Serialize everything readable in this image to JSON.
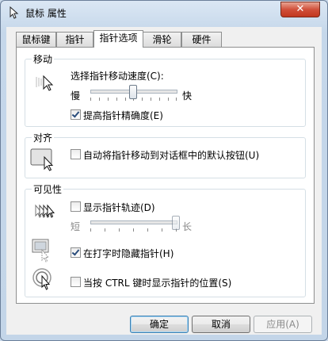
{
  "window": {
    "title": "鼠标 属性",
    "close_label": "✕"
  },
  "tabs": [
    {
      "label": "鼠标键"
    },
    {
      "label": "指针"
    },
    {
      "label": "指针选项",
      "active": true
    },
    {
      "label": "滑轮"
    },
    {
      "label": "硬件"
    }
  ],
  "motion": {
    "title": "移动",
    "speed_label": "选择指针移动速度(C):",
    "slow_label": "慢",
    "fast_label": "快",
    "speed_level_fraction": 0.5,
    "precision_label": "提高指针精确度(E)",
    "precision_checked": true
  },
  "snap": {
    "title": "对齐",
    "snap_label": "自动将指针移动到对话框中的默认按钮(U)",
    "snap_checked": false
  },
  "visibility": {
    "title": "可见性",
    "trails_label": "显示指针轨迹(D)",
    "trails_checked": false,
    "short_label": "短",
    "long_label": "长",
    "trails_level_fraction": 1.0,
    "hide_label": "在打字时隐藏指针(H)",
    "hide_checked": true,
    "ctrl_label": "当按 CTRL 键时显示指针的位置(S)",
    "ctrl_checked": false
  },
  "buttons": {
    "ok": "确定",
    "cancel": "取消",
    "apply": "应用(A)"
  }
}
